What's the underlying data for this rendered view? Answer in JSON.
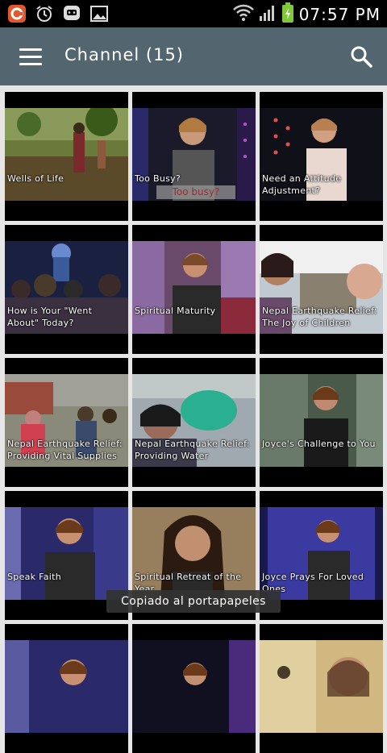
{
  "status_bar": {
    "time": "07:57 PM",
    "icons": [
      "app-notification-icon",
      "alarm-icon",
      "chat-icon",
      "image-icon",
      "wifi-icon",
      "signal-icon",
      "battery-icon"
    ]
  },
  "app_bar": {
    "title": "Channel (15)",
    "menu_icon": "hamburger-menu-icon",
    "search_icon": "search-icon",
    "background": "#53656f"
  },
  "videos": [
    {
      "title": "Wells of Life"
    },
    {
      "title": "Too Busy?",
      "caption": "Too busy?"
    },
    {
      "title": "Need an Attitude Adjustment?"
    },
    {
      "title": "How is Your \"Went About\" Today?"
    },
    {
      "title": "Spiritual Maturity"
    },
    {
      "title": "Nepal Earthquake Relief: The Joy of Children"
    },
    {
      "title": "Nepal Earthquake Relief: Providing Vital Supplies"
    },
    {
      "title": "Nepal Earthquake Relief: Providing Water"
    },
    {
      "title": "Joyce's Challenge to You"
    },
    {
      "title": "Speak Faith"
    },
    {
      "title": "Spiritual Retreat of the Year"
    },
    {
      "title": "Joyce Prays For Loved Ones"
    },
    {
      "title": ""
    },
    {
      "title": ""
    },
    {
      "title": ""
    }
  ],
  "toast": {
    "text": "Copiado al portapapeles"
  }
}
